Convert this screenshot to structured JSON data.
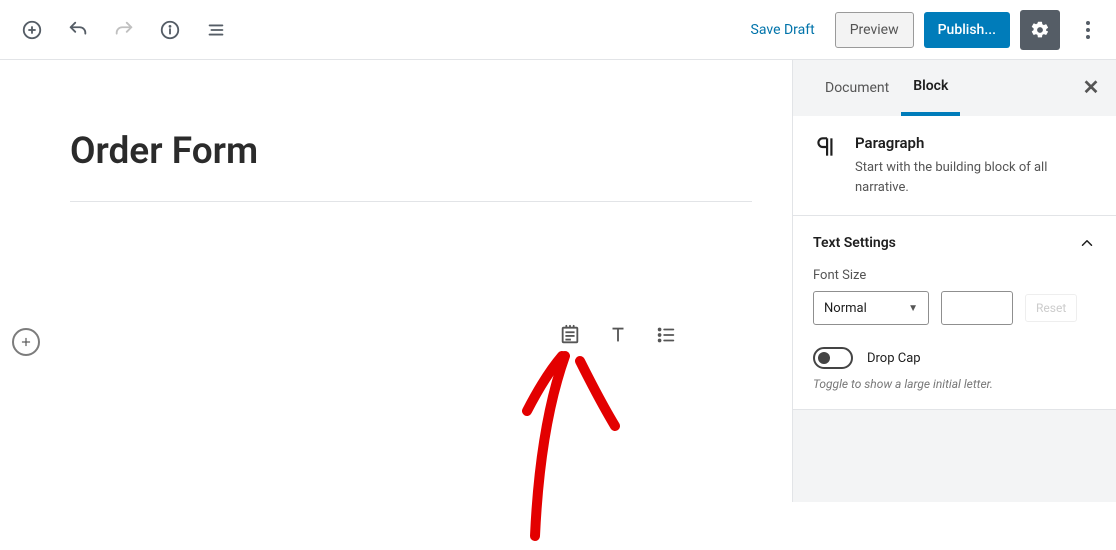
{
  "toolbar": {
    "save_draft": "Save Draft",
    "preview": "Preview",
    "publish": "Publish..."
  },
  "editor": {
    "title": "Order Form"
  },
  "sidebar": {
    "tabs": {
      "document": "Document",
      "block": "Block"
    },
    "block_card": {
      "title": "Paragraph",
      "desc": "Start with the building block of all narrative."
    },
    "text_settings": {
      "title": "Text Settings",
      "font_size_label": "Font Size",
      "font_size_value": "Normal",
      "reset_label": "Reset",
      "drop_cap_label": "Drop Cap",
      "drop_cap_hint": "Toggle to show a large initial letter."
    }
  }
}
